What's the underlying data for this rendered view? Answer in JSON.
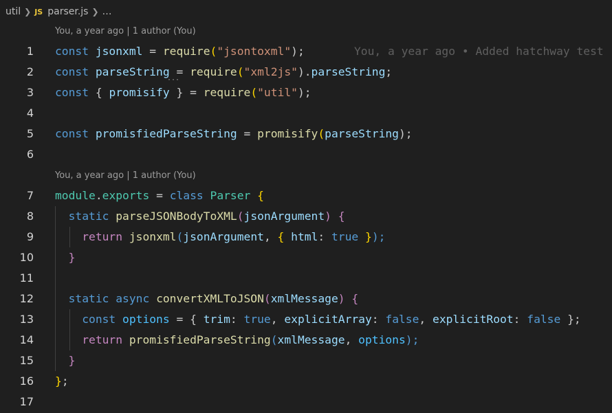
{
  "breadcrumb": {
    "folder": "util",
    "file_icon": "JS",
    "file": "parser.js",
    "ellipsis": "…"
  },
  "code_lens": [
    "You, a year ago | 1 author (You)",
    "You, a year ago | 1 author (You)"
  ],
  "blame": "You, a year ago • Added hatchway test",
  "line_numbers": [
    "1",
    "2",
    "3",
    "4",
    "5",
    "6",
    "7",
    "8",
    "9",
    "10",
    "11",
    "12",
    "13",
    "14",
    "15",
    "16",
    "17"
  ],
  "code": {
    "l1": [
      "const",
      " ",
      "jsonxml",
      " = ",
      "require",
      "(",
      "\"jsontoxml\"",
      ");"
    ],
    "l2": [
      "const",
      " ",
      "parseString",
      " = ",
      "require",
      "(",
      "\"xml2js\"",
      ").",
      "parseString",
      ";"
    ],
    "l3": [
      "const",
      " { ",
      "promisify",
      " } = ",
      "require",
      "(",
      "\"util\"",
      ");"
    ],
    "l5": [
      "const",
      " ",
      "promisfiedParseString",
      " = ",
      "promisify",
      "(",
      "parseString",
      ");"
    ],
    "l7": [
      "module",
      ".",
      "exports",
      " = ",
      "class",
      " ",
      "Parser",
      " ",
      "{"
    ],
    "l8": [
      "static",
      " ",
      "parseJSONBodyToXML",
      "(",
      "jsonArgument",
      ") ",
      "{"
    ],
    "l9": [
      "return",
      " ",
      "jsonxml",
      "(",
      "jsonArgument",
      ", ",
      "{",
      " ",
      "html",
      ": ",
      "true",
      " ",
      "}",
      ");"
    ],
    "l10": [
      "}"
    ],
    "l12": [
      "static",
      " ",
      "async",
      " ",
      "convertXMLToJSON",
      "(",
      "xmlMessage",
      ") ",
      "{"
    ],
    "l13": [
      "const",
      " ",
      "options",
      " = { ",
      "trim",
      ": ",
      "true",
      ", ",
      "explicitArray",
      ": ",
      "false",
      ", ",
      "explicitRoot",
      ": ",
      "false",
      " };"
    ],
    "l14": [
      "return",
      " ",
      "promisfiedParseString",
      "(",
      "xmlMessage",
      ", ",
      "options",
      ");"
    ],
    "l15": [
      "}"
    ],
    "l16": [
      "}",
      ";"
    ]
  },
  "colors": {
    "background": "#1f1f1f",
    "keyword": "#569cd6",
    "control": "#c586c0",
    "variable": "#9cdcfe",
    "function": "#dcdcaa",
    "string": "#ce9178",
    "class": "#4ec9b0",
    "bracket": "#ffd700",
    "js_icon": "#e8c33a"
  }
}
